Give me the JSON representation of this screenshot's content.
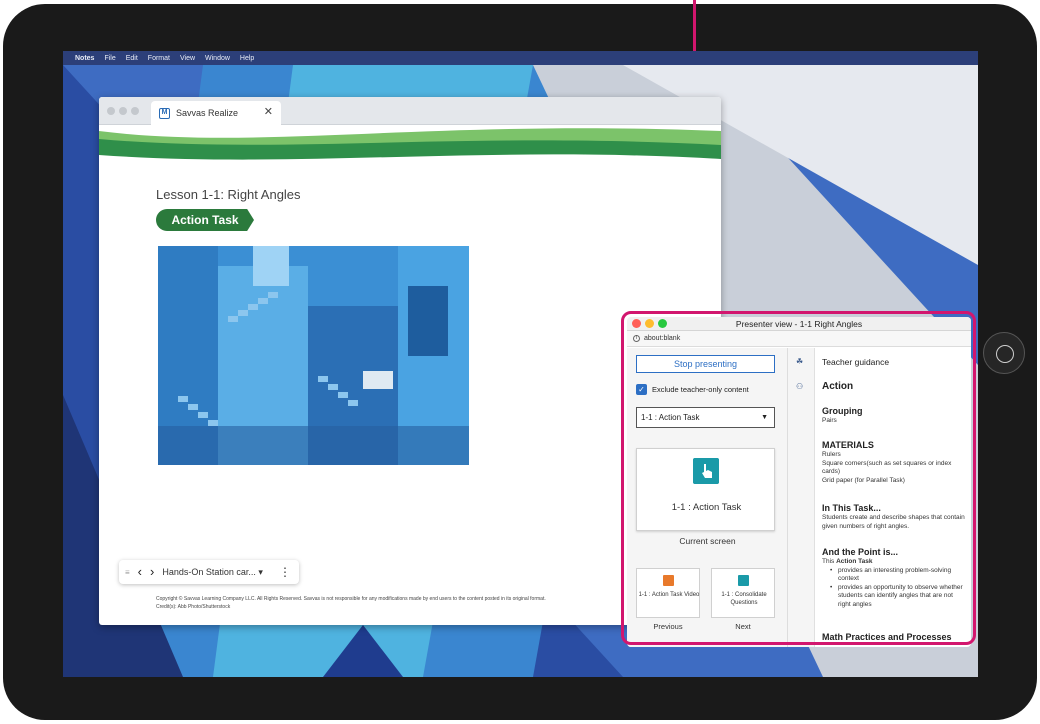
{
  "menubar": {
    "items": [
      "Notes",
      "File",
      "Edit",
      "Format",
      "View",
      "Window",
      "Help"
    ]
  },
  "browser": {
    "tab_title": "Savvas Realize",
    "tab_close": "✕",
    "lesson_title": "Lesson 1-1: Right Angles",
    "badge": "Action Task",
    "nav": {
      "grip": "≡",
      "prev": "‹",
      "next": "›",
      "label": "Hands-On Station car...",
      "caret": "▾",
      "menu": "⋮"
    },
    "copyright_line1": "Copyright © Savvas Learning Company LLC. All Rights Reserved. Savvas is not responsible for any modifications made by end users to the content posted in its original format.",
    "copyright_line2": "Credit(s): Abb Photo/Shutterstock"
  },
  "presenter": {
    "title": "Presenter view - 1-1 Right Angles",
    "address": "about:blank",
    "stop_button": "Stop presenting",
    "exclude_label": "Exclude teacher-only content",
    "check": "✓",
    "select_value": "1-1 : Action Task",
    "select_caret": "▼",
    "current_card": "1-1 : Action Task",
    "current_caption": "Current screen",
    "prev_card": "1-1 : Action Task Video",
    "prev_caption": "Previous",
    "next_card": "1-1 : Consolidate Questions",
    "next_caption": "Next",
    "guidance": {
      "header": "Teacher guidance",
      "action": "Action",
      "grouping_title": "Grouping",
      "grouping_text": "Pairs",
      "materials_title": "MATERIALS",
      "materials_items": [
        "Rulers",
        "Square corners(such as set squares or index cards)",
        "Grid paper (for Parallel Task)"
      ],
      "task_title": "In This Task...",
      "task_text": "Students create and describe shapes that contain given numbers of right angles.",
      "point_title": "And the Point is...",
      "point_intro_prefix": "This",
      "point_intro_bold": "Action Task",
      "point_items": [
        "provides an interesting problem-solving context",
        "provides an opportunity to observe whether students can identify angles that are not right angles"
      ],
      "practices_title": "Math Practices and Processes"
    }
  },
  "colors": {
    "highlight": "#d2166e",
    "badge_green": "#2b7a3c",
    "accent_blue": "#2d6fc4",
    "teal_icon": "#1a9aa8",
    "orange_icon": "#e8792b"
  }
}
